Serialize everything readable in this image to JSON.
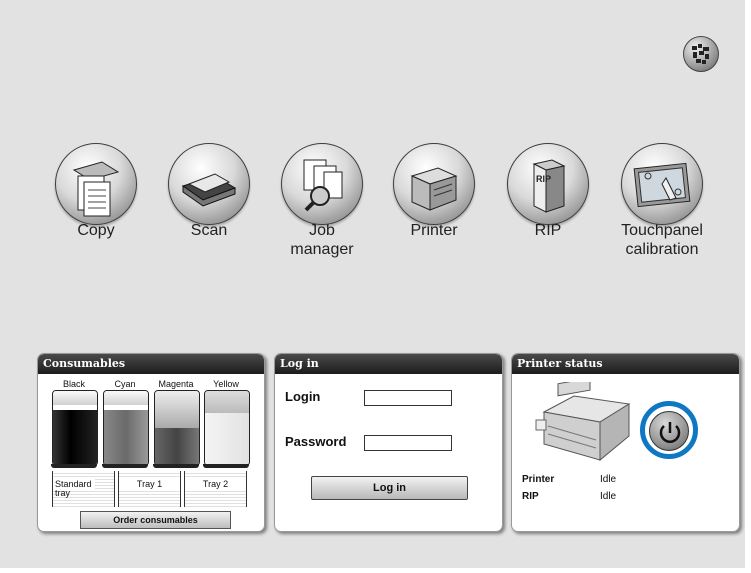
{
  "apps": [
    {
      "id": "copy",
      "label": "Copy"
    },
    {
      "id": "scan",
      "label": "Scan"
    },
    {
      "id": "job-manager",
      "label": "Job\nmanager"
    },
    {
      "id": "printer",
      "label": "Printer"
    },
    {
      "id": "rip",
      "label": "RIP",
      "icon_text": "RIP"
    },
    {
      "id": "touchpanel-calibration",
      "label": "Touchpanel\ncalibration"
    }
  ],
  "consumables": {
    "title": "Consumables",
    "toners": [
      {
        "name": "Black",
        "level": 0.75,
        "color": "#111111"
      },
      {
        "name": "Cyan",
        "level": 0.75,
        "color": "#7a7a7a"
      },
      {
        "name": "Magenta",
        "level": 0.5,
        "color": "#555555"
      },
      {
        "name": "Yellow",
        "level": 0.7,
        "color": "#e8e8e8"
      }
    ],
    "trays": [
      {
        "name": "Standard",
        "sub": "tray"
      },
      {
        "name": "Tray 1",
        "sub": ""
      },
      {
        "name": "Tray 2",
        "sub": ""
      }
    ],
    "order_button": "Order consumables"
  },
  "login": {
    "title": "Log in",
    "login_label": "Login",
    "login_value": "",
    "password_label": "Password",
    "password_value": "",
    "button": "Log in"
  },
  "status": {
    "title": "Printer status",
    "rows": [
      {
        "key": "Printer",
        "value": "Idle"
      },
      {
        "key": "RIP",
        "value": "Idle"
      }
    ],
    "power_highlight_color": "#0e78c5"
  }
}
